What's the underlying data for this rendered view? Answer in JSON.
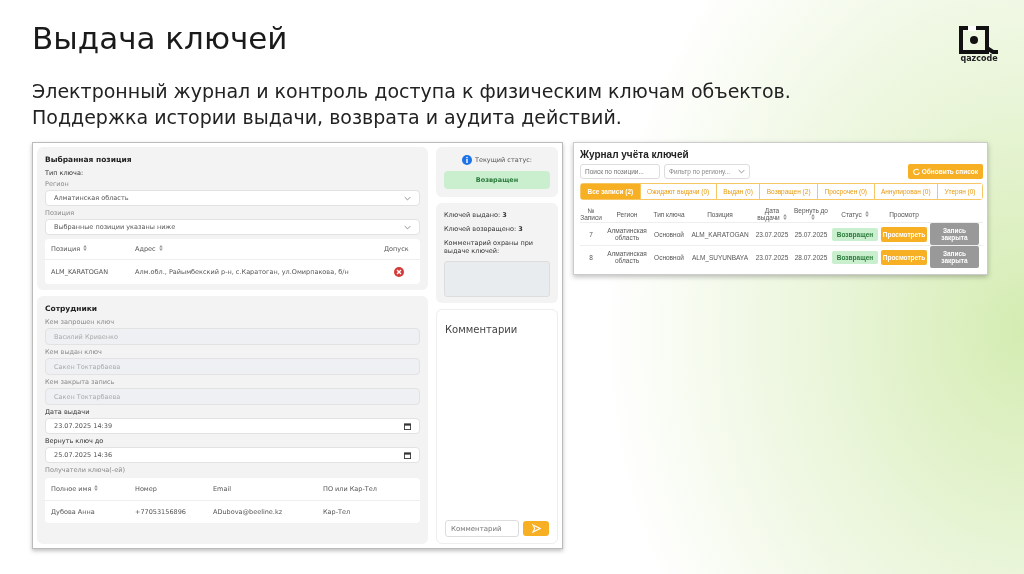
{
  "slide": {
    "title": "Выдача ключей",
    "subtitle_lines": [
      "Электронный журнал и контроль доступа к физическим ключам объектов.",
      "Поддержка истории выдачи, возврата и аудита действий."
    ],
    "logo_text": "qazcode"
  },
  "form_screen": {
    "position_card": {
      "heading": "Выбранная позиция",
      "key_type_label": "Тип ключа:",
      "selects": [
        {
          "label": "Регион",
          "value": "Алматинская область"
        },
        {
          "label": "Позиция",
          "value": "Выбранные позиции указаны ниже"
        }
      ],
      "table": {
        "columns": [
          {
            "label": "Позиция",
            "sortable": true
          },
          {
            "label": "Адрес",
            "sortable": true
          },
          {
            "label": "Допуск",
            "sortable": false
          }
        ],
        "rows": [
          {
            "cells": [
              "ALM_KARATOGAN",
              "Алм.обл., Райымбекский р-н, с.Каратоган, ул.Омирпакова, б/н"
            ],
            "access": false
          }
        ]
      }
    },
    "status_card": {
      "label": "Текущий статус:",
      "status": "Возвращен"
    },
    "counts_card": {
      "lines": [
        "Ключей выдано: **3**",
        "Ключей возвращено: **3**"
      ],
      "guard_comment_label": "Комментарий охраны при выдаче ключей:"
    },
    "employees_card": {
      "heading": "Сотрудники",
      "fields": [
        {
          "kind": "readonly",
          "label": "Кем запрошен ключ",
          "value": "Василий Кривенко"
        },
        {
          "kind": "readonly",
          "label": "Кем выдан ключ",
          "value": "Сакен Токтарбаева"
        },
        {
          "kind": "readonly",
          "label": "Кем закрыта запись",
          "value": "Сакен Токтарбаева"
        },
        {
          "kind": "date",
          "label": "Дата выдачи",
          "value": "23.07.2025  14:39"
        },
        {
          "kind": "date",
          "label": "Вернуть ключ до",
          "value": "25.07.2025  14:36"
        }
      ],
      "recipients_label": "Получатели ключа(-ей)",
      "table": {
        "columns": [
          {
            "label": "Полное имя",
            "sortable": true
          },
          {
            "label": "Номер",
            "sortable": false
          },
          {
            "label": "Email",
            "sortable": false
          },
          {
            "label": "ПО или Кар-Тел",
            "sortable": false
          }
        ],
        "rows": [
          [
            "Дубова Анна",
            "+77053156896",
            "ADubova@beeline.kz",
            "Кар-Тел"
          ]
        ]
      }
    },
    "comments_card": {
      "heading": "Комментарии",
      "placeholder": "Комментарий"
    }
  },
  "journal_screen": {
    "title": "Журнал учёта ключей",
    "search_placeholder": "Поиск по позиции...",
    "filter_placeholder": "Фильтр по региону...",
    "refresh_button": "Обновить список",
    "tabs": [
      {
        "label": "Все записи (2)",
        "selected": true
      },
      {
        "label": "Ожидают выдачи (0)",
        "selected": false
      },
      {
        "label": "Выдан (0)",
        "selected": false
      },
      {
        "label": "Возвращен (2)",
        "selected": false
      },
      {
        "label": "Просрочен (0)",
        "selected": false
      },
      {
        "label": "Аннулирован (0)",
        "selected": false
      },
      {
        "label": "Утерян (0)",
        "selected": false
      }
    ],
    "columns": [
      {
        "label": "№ Записи",
        "sortable": false
      },
      {
        "label": "Регион",
        "sortable": false
      },
      {
        "label": "Тип ключа",
        "sortable": false
      },
      {
        "label": "Позиция",
        "sortable": false
      },
      {
        "label": "Дата выдачи",
        "sortable": true
      },
      {
        "label": "Вернуть до",
        "sortable": true
      },
      {
        "label": "Статус",
        "sortable": true
      },
      {
        "label": "Просмотр",
        "sortable": false
      }
    ],
    "rows": [
      {
        "cells": [
          "7",
          "Алматинская область",
          "Основной",
          "ALM_KARATOGAN",
          "23.07.2025",
          "25.07.2025"
        ],
        "status": "Возвращен",
        "view_button": "Просмотреть",
        "closed_button": "Запись закрыта"
      },
      {
        "cells": [
          "8",
          "Алматинская область",
          "Основной",
          "ALM_SUYUNBAYA",
          "23.07.2025",
          "28.07.2025"
        ],
        "status": "Возвращен",
        "view_button": "Просмотреть",
        "closed_button": "Запись закрыта"
      }
    ]
  }
}
